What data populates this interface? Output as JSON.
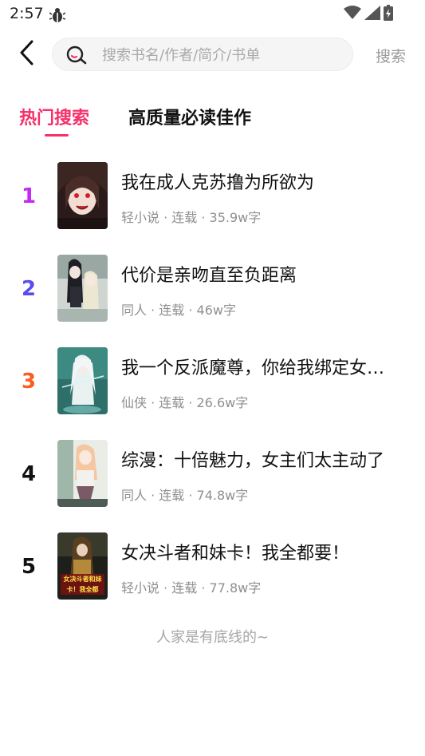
{
  "status_bar": {
    "time": "2:57"
  },
  "search": {
    "placeholder": "搜索书名/作者/简介/书单",
    "value": "",
    "button_label": "搜索"
  },
  "tabs": [
    {
      "label": "热门搜索",
      "active": true
    },
    {
      "label": "高质量必读佳作",
      "active": false
    }
  ],
  "books": [
    {
      "rank": "1",
      "title": "我在成人克苏撸为所欲为",
      "meta": "轻小说 · 连载 · 35.9w字",
      "rank_color": "#c32cf0"
    },
    {
      "rank": "2",
      "title": "代价是亲吻直至负距离",
      "meta": "同人 · 连载 · 46w字",
      "rank_color": "#5b4cf0"
    },
    {
      "rank": "3",
      "title": "我一个反派魔尊，你给我绑定女…",
      "meta": "仙侠 · 连载 · 26.6w字",
      "rank_color": "#ff5a1f"
    },
    {
      "rank": "4",
      "title": "综漫：十倍魅力，女主们太主动了",
      "meta": "同人 · 连载 · 74.8w字",
      "rank_color": "#111111"
    },
    {
      "rank": "5",
      "title": "女决斗者和妹卡！我全都要！",
      "meta": "轻小说 · 连载 · 77.8w字",
      "rank_color": "#111111"
    }
  ],
  "cover_text_5": "女决斗者和妹卡！我全都要！",
  "footer_note": "人家是有底线的~",
  "colors": {
    "accent": "#f5306a"
  }
}
